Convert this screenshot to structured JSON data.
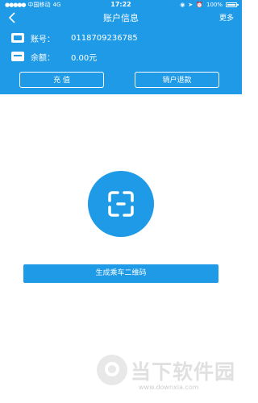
{
  "statusbar": {
    "carrier": "中国移动",
    "network": "4G",
    "time": "17:22",
    "battery": "100%"
  },
  "navbar": {
    "back_icon": "chevron-left-icon",
    "title": "账户信息",
    "more_label": "更多"
  },
  "account": {
    "number_label": "账号：",
    "number_value": "0118709236785",
    "balance_label": "余额：",
    "balance_value": "0.00元"
  },
  "actions": {
    "recharge_label": "充 值",
    "cancel_refund_label": "销户退款"
  },
  "main": {
    "scan_icon": "scan-icon",
    "generate_qr_label": "生成乘车二维码"
  },
  "watermark": {
    "text": "当下软件园",
    "url": "www.downxia.com"
  },
  "colors": {
    "brand_blue": "#1e9ae6"
  }
}
